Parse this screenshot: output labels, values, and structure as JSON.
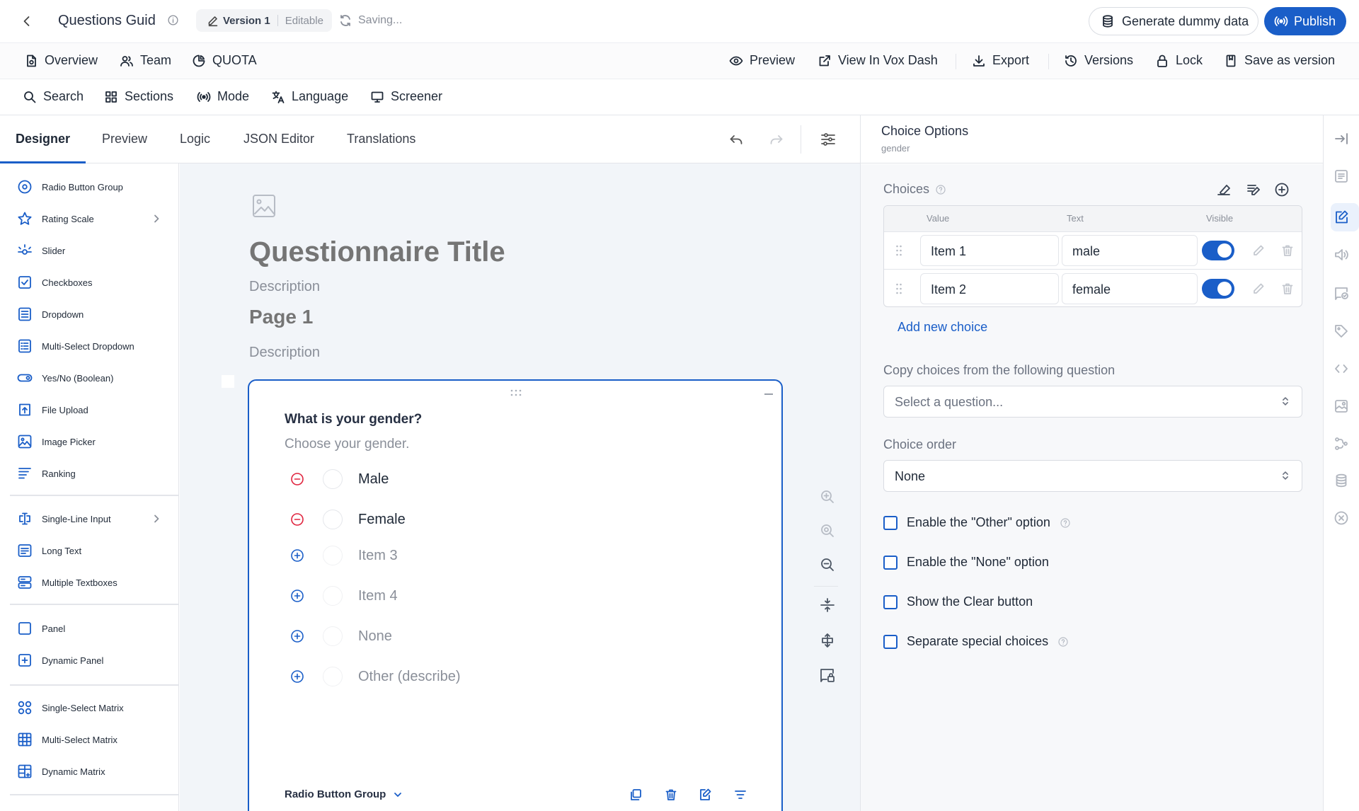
{
  "header": {
    "title": "Questions Guid",
    "version_label": "Version 1",
    "version_state": "Editable",
    "saving": "Saving...",
    "generate_label": "Generate dummy data",
    "publish_label": "Publish"
  },
  "nav": {
    "left": [
      {
        "label": "Overview",
        "icon": "file-icon"
      },
      {
        "label": "Team",
        "icon": "users-icon"
      },
      {
        "label": "QUOTA",
        "icon": "pie-chart-icon"
      }
    ],
    "right": [
      {
        "label": "Preview",
        "icon": "eye-icon"
      },
      {
        "label": "View In Vox Dash",
        "icon": "external-link-icon"
      },
      {
        "label": "Export",
        "icon": "download-icon"
      },
      {
        "label": "Versions",
        "icon": "history-icon"
      },
      {
        "label": "Lock",
        "icon": "lock-icon"
      },
      {
        "label": "Save as version",
        "icon": "bookmark-icon"
      }
    ]
  },
  "toolbar": [
    {
      "label": "Search",
      "icon": "search-icon"
    },
    {
      "label": "Sections",
      "icon": "grid-icon"
    },
    {
      "label": "Mode",
      "icon": "broadcast-icon"
    },
    {
      "label": "Language",
      "icon": "translate-icon"
    },
    {
      "label": "Screener",
      "icon": "monitor-icon"
    }
  ],
  "tabs": [
    "Designer",
    "Preview",
    "Logic",
    "JSON Editor",
    "Translations"
  ],
  "toolbox": {
    "items": [
      {
        "label": "Radio Button Group",
        "icon": "radio-icon"
      },
      {
        "label": "Rating Scale",
        "icon": "star-icon",
        "submenu": true
      },
      {
        "label": "Slider",
        "icon": "slider-icon"
      },
      {
        "label": "Checkboxes",
        "icon": "checkbox-icon"
      },
      {
        "label": "Dropdown",
        "icon": "dropdown-icon"
      },
      {
        "label": "Multi-Select Dropdown",
        "icon": "multi-dropdown-icon"
      },
      {
        "label": "Yes/No (Boolean)",
        "icon": "toggle-icon"
      },
      {
        "label": "File Upload",
        "icon": "upload-icon"
      },
      {
        "label": "Image Picker",
        "icon": "image-icon"
      },
      {
        "label": "Ranking",
        "icon": "ranking-icon"
      },
      {
        "label": "Single-Line Input",
        "icon": "text-cursor-icon",
        "submenu": true
      },
      {
        "label": "Long Text",
        "icon": "long-text-icon"
      },
      {
        "label": "Multiple Textboxes",
        "icon": "textboxes-icon"
      },
      {
        "label": "Panel",
        "icon": "panel-icon"
      },
      {
        "label": "Dynamic Panel",
        "icon": "dynamic-panel-icon"
      },
      {
        "label": "Single-Select Matrix",
        "icon": "matrix-single-icon"
      },
      {
        "label": "Multi-Select Matrix",
        "icon": "matrix-multi-icon"
      },
      {
        "label": "Dynamic Matrix",
        "icon": "matrix-dynamic-icon"
      }
    ]
  },
  "canvas": {
    "title": "Questionnaire Title",
    "description": "Description",
    "page_title": "Page 1",
    "page_description": "Description",
    "question": {
      "title": "What is your gender?",
      "description": "Choose your gender.",
      "choices": [
        {
          "label": "Male",
          "kind": "existing"
        },
        {
          "label": "Female",
          "kind": "existing"
        },
        {
          "label": "Item 3",
          "kind": "add"
        },
        {
          "label": "Item 4",
          "kind": "add"
        },
        {
          "label": "None",
          "kind": "add"
        },
        {
          "label": "Other (describe)",
          "kind": "add"
        }
      ],
      "type_label": "Radio Button Group"
    }
  },
  "panel": {
    "title": "Choice Options",
    "subtitle": "gender",
    "choices_label": "Choices",
    "columns": [
      "Value",
      "Text",
      "Visible"
    ],
    "rows": [
      {
        "value": "Item 1",
        "text": "male",
        "visible": true
      },
      {
        "value": "Item 2",
        "text": "female",
        "visible": true
      }
    ],
    "add_choice": "Add new choice",
    "copy_label": "Copy choices from the following question",
    "copy_placeholder": "Select a question...",
    "order_label": "Choice order",
    "order_value": "None",
    "checkboxes": [
      {
        "label": "Enable the \"Other\" option",
        "checked": false,
        "help": true
      },
      {
        "label": "Enable the \"None\" option",
        "checked": false,
        "help": false
      },
      {
        "label": "Show the Clear button",
        "checked": false,
        "help": false
      },
      {
        "label": "Separate special choices",
        "checked": false,
        "help": true
      }
    ]
  },
  "colors": {
    "accent": "#1a5ec8",
    "danger": "#e0243e"
  }
}
